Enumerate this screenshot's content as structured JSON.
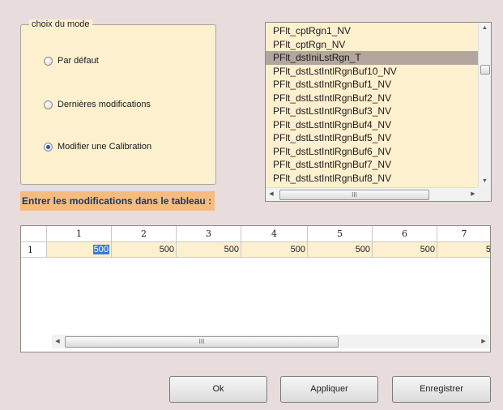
{
  "mode_group": {
    "title": "choix du mode",
    "options": [
      {
        "label": "Par défaut",
        "checked": false
      },
      {
        "label": "Dernières modifications",
        "checked": false
      },
      {
        "label": "Modifier une Calibration",
        "checked": true
      }
    ]
  },
  "listbox": {
    "items": [
      "PFlt_cptRgn1_NV",
      "PFlt_cptRgn_NV",
      "PFlt_dstIniLstRgn_T",
      "PFlt_dstLstIntlRgnBuf10_NV",
      "PFlt_dstLstIntlRgnBuf1_NV",
      "PFlt_dstLstIntlRgnBuf2_NV",
      "PFlt_dstLstIntlRgnBuf3_NV",
      "PFlt_dstLstIntlRgnBuf4_NV",
      "PFlt_dstLstIntlRgnBuf5_NV",
      "PFlt_dstLstIntlRgnBuf6_NV",
      "PFlt_dstLstIntlRgnBuf7_NV",
      "PFlt_dstLstIntlRgnBuf8_NV"
    ],
    "selected_index": 2,
    "hscroll_grip": "III"
  },
  "instruction": "Entrer les modifications dans le tableau :",
  "table": {
    "columns": [
      "1",
      "2",
      "3",
      "4",
      "5",
      "6",
      "7"
    ],
    "rows": [
      {
        "header": "1",
        "values": [
          "500",
          "500",
          "500",
          "500",
          "500",
          "500",
          "5"
        ]
      }
    ],
    "selected_cell": 0,
    "hscroll_grip": "III"
  },
  "buttons": {
    "ok": "Ok",
    "apply": "Appliquer",
    "save": "Enregistrer"
  },
  "colors": {
    "background": "#e8dcdc",
    "panel": "#fdf0cf",
    "selection": "#b3a69e",
    "instruction_bg": "#f6bc7f",
    "instruction_text": "#123c6a",
    "cell_selection": "#3a7bd5"
  }
}
